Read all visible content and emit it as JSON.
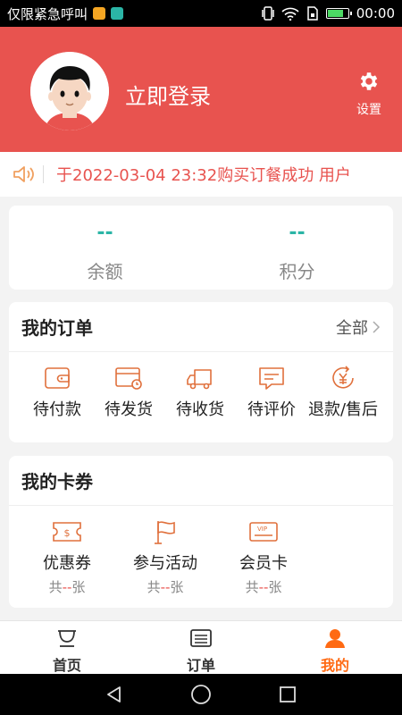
{
  "status_bar": {
    "carrier": "仅限紧急呼叫",
    "time": "00:00",
    "app_icon_colors": [
      "#f5a623",
      "#2bb5a6"
    ]
  },
  "header": {
    "login_label": "立即登录",
    "settings_label": "设置",
    "bg_color": "#e8534f"
  },
  "marquee": {
    "text": "于2022-03-04 23:32购买订餐成功   用户"
  },
  "balance": [
    {
      "value": "--",
      "label": "余额"
    },
    {
      "value": "--",
      "label": "积分"
    }
  ],
  "orders": {
    "title": "我的订单",
    "all_label": "全部",
    "items": [
      {
        "label": "待付款",
        "icon": "wallet-icon"
      },
      {
        "label": "待发货",
        "icon": "card-clock-icon"
      },
      {
        "label": "待收货",
        "icon": "truck-icon"
      },
      {
        "label": "待评价",
        "icon": "comment-icon"
      },
      {
        "label": "退款/售后",
        "icon": "refund-icon"
      }
    ]
  },
  "coupons": {
    "title": "我的卡券",
    "items": [
      {
        "label": "优惠券",
        "count_prefix": "共",
        "count": "--",
        "count_suffix": "张",
        "icon": "coupon-icon"
      },
      {
        "label": "参与活动",
        "count_prefix": "共",
        "count": "--",
        "count_suffix": "张",
        "icon": "flag-icon"
      },
      {
        "label": "会员卡",
        "count_prefix": "共",
        "count": "--",
        "count_suffix": "张",
        "icon": "vip-card-icon"
      }
    ]
  },
  "bottom_nav": [
    {
      "label": "首页",
      "icon": "bowl-icon"
    },
    {
      "label": "订单",
      "icon": "list-icon"
    },
    {
      "label": "我的",
      "icon": "user-icon",
      "active": true
    }
  ],
  "colors": {
    "accent": "#e8534f",
    "teal": "#2bb5a6",
    "active_tab": "#ff6a13"
  }
}
